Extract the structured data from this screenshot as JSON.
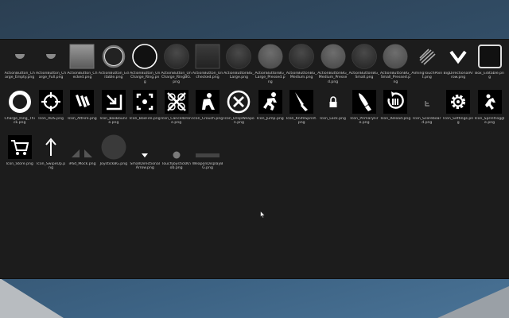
{
  "files": [
    {
      "label": "ActionButton_Charge_Empty.png",
      "icon": "half-disc-small-icon"
    },
    {
      "label": "ActionButton_Charge_Full.png",
      "icon": "half-disc-small-icon"
    },
    {
      "label": "ActionButton_Checked.png",
      "icon": "gray-square-icon"
    },
    {
      "label": "ActionButton_Editable.png",
      "icon": "glow-ring-icon"
    },
    {
      "label": "ActionButton_UnCharge_Ring.png",
      "icon": "white-ring-icon"
    },
    {
      "label": "ActionButton_UnCharge_RingBG.png",
      "icon": "dark-disc-icon"
    },
    {
      "label": "ActionButton_Unchecked.png",
      "icon": "dark-square-icon"
    },
    {
      "label": "ActionButtonBG_Large.png",
      "icon": "dark-disc-icon"
    },
    {
      "label": "ActionButtonBG_Large_Pressed.png",
      "icon": "gray-disc-icon"
    },
    {
      "label": "ActionButtonBG_Medium.png",
      "icon": "dark-disc-icon"
    },
    {
      "label": "ActionButtonBG_Medium_Pressed.png",
      "icon": "gray-disc-icon"
    },
    {
      "label": "ActionButtonBG_Small.png",
      "icon": "dark-disc-icon"
    },
    {
      "label": "ActionButtonBG_Small_Pressed.png",
      "icon": "gray-disc-icon"
    },
    {
      "label": "AimingTouchPoint.png",
      "icon": "scribble-icon"
    },
    {
      "label": "BigDirectionalArrow.png",
      "icon": "chevron-down-icon"
    },
    {
      "label": "Box_Editable.png",
      "icon": "outlined-box-icon"
    },
    {
      "label": "Charge_Ring_Thick.png",
      "icon": "thick-ring-icon"
    },
    {
      "label": "Icon_ADS.png",
      "icon": "crosshair-icon"
    },
    {
      "label": "Icon_AltFire.png",
      "icon": "bullets-icon"
    },
    {
      "label": "Icon_BoxBounce.png",
      "icon": "bounce-arrow-icon"
    },
    {
      "label": "Icon_BoxFire.png",
      "icon": "target-icon"
    },
    {
      "label": "Icon_CancelDrone.png",
      "icon": "cancel-drone-icon"
    },
    {
      "label": "Icon_Crouch.png",
      "icon": "crouch-icon"
    },
    {
      "label": "Icon_DropWeapon.png",
      "icon": "drop-weapon-icon"
    },
    {
      "label": "Icon_Jump.png",
      "icon": "jump-icon"
    },
    {
      "label": "Icon_KnifeSprint.png",
      "icon": "knife-icon"
    },
    {
      "label": "Icon_Lock.png",
      "icon": "lock-icon"
    },
    {
      "label": "Icon_PrimaryFire.png",
      "icon": "bullet-icon"
    },
    {
      "label": "Icon_Reload.png",
      "icon": "reload-icon"
    },
    {
      "label": "Icon_Scoreboard.png",
      "icon": "scoreboard-icon"
    },
    {
      "label": "Icon_Settings.png",
      "icon": "gear-icon"
    },
    {
      "label": "Icon_SprintToggle.png",
      "icon": "sprint-icon"
    },
    {
      "label": "Icon_Store.png",
      "icon": "cart-icon"
    },
    {
      "label": "Icon_SwipeUp.png",
      "icon": "arrow-up-icon"
    },
    {
      "label": "iPad_Mock.png",
      "icon": "ipad-icon"
    },
    {
      "label": "JoystickBG.png",
      "icon": "joystick-bg-icon"
    },
    {
      "label": "SmallDirectionalArrow.png",
      "icon": "small-arrow-icon"
    },
    {
      "label": "TouchJoystickKnob.png",
      "icon": "knob-icon"
    },
    {
      "label": "WeaponDisplayBG.png",
      "icon": "weapon-bar-icon"
    }
  ]
}
